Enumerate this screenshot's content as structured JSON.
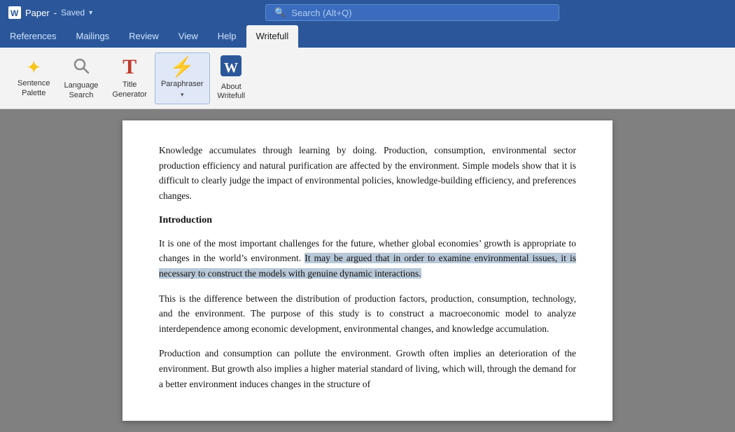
{
  "titlebar": {
    "doc_name": "Paper",
    "saved_label": "Saved",
    "dropdown_arrow": "▾",
    "search_placeholder": "Search (Alt+Q)"
  },
  "ribbon_tabs": [
    {
      "label": "References",
      "active": false
    },
    {
      "label": "Mailings",
      "active": false
    },
    {
      "label": "Review",
      "active": false
    },
    {
      "label": "View",
      "active": false
    },
    {
      "label": "Help",
      "active": false
    },
    {
      "label": "Writefull",
      "active": true
    }
  ],
  "ribbon_buttons": [
    {
      "id": "sentence-palette",
      "label_line1": "Sentence",
      "label_line2": "Palette",
      "icon": "✦",
      "icon_class": "icon-star",
      "has_chevron": false
    },
    {
      "id": "language-search",
      "label_line1": "Language",
      "label_line2": "Search",
      "icon": "🔍",
      "icon_class": "icon-search",
      "has_chevron": false
    },
    {
      "id": "title-generator",
      "label_line1": "Title",
      "label_line2": "Generator",
      "icon": "T",
      "icon_class": "icon-title",
      "has_chevron": false
    },
    {
      "id": "paraphraser",
      "label_line1": "Paraphraser",
      "label_line2": "",
      "icon": "⚡",
      "icon_class": "icon-bolt",
      "has_chevron": true,
      "active": true
    },
    {
      "id": "about-writefull",
      "label_line1": "About",
      "label_line2": "Writefull",
      "icon": "W",
      "icon_class": "icon-w",
      "has_chevron": false
    }
  ],
  "document": {
    "paragraphs": [
      {
        "id": "p1",
        "text": "Knowledge accumulates through learning by doing. Production, consumption, environmental sector production efficiency and natural purification are affected by the environment. Simple models show that it is difficult to clearly judge the impact of environmental policies, knowledge-building efficiency, and preferences changes."
      },
      {
        "id": "heading1",
        "text": "Introduction",
        "type": "heading"
      },
      {
        "id": "p2",
        "text_before": "It is one of the most important challenges for the future, whether global economies’ growth is appropriate to changes in the world’s environment. ",
        "text_highlighted": "It may be argued that in order to examine environmental issues, it is necessary to construct the models with genuine dynamic interactions.",
        "text_after": "",
        "has_highlight": true
      },
      {
        "id": "p3",
        "text": "This is the difference between the distribution of production factors, production, consumption, technology, and the environment. The purpose of this study is to construct a macroeconomic model to analyze interdependence among economic development, environmental changes, and knowledge accumulation."
      },
      {
        "id": "p4",
        "text": "Production and consumption can pollute the environment. Growth often implies an deterioration of the environment. But growth also implies a higher material standard of living, which will, through the demand for a better environment induces changes in the structure of"
      }
    ]
  }
}
